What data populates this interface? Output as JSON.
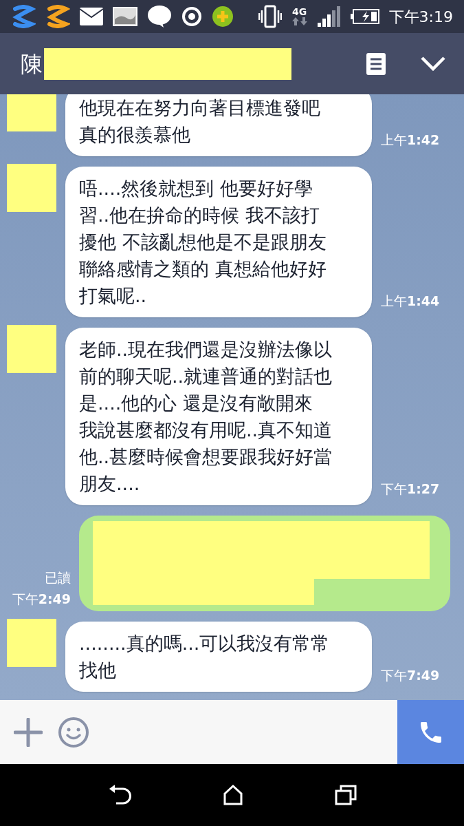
{
  "status_bar": {
    "network": "4G",
    "time": "下午3:19"
  },
  "header": {
    "title": "陳"
  },
  "messages": [
    {
      "kind": "incoming",
      "lines": [
        "他現在在努力向著目標進發吧",
        "真的很羨慕他"
      ],
      "time": "上午**1:42**"
    },
    {
      "kind": "incoming",
      "lines": [
        "唔....然後就想到 他要好好學",
        "習..他在拚命的時候 我不該打",
        "擾他 不該亂想他是不是跟朋友",
        "聯絡感情之類的 真想給他好好",
        "打氣呢.."
      ],
      "time": "上午**1:44**"
    },
    {
      "kind": "incoming",
      "lines": [
        "老師..現在我們還是沒辦法像以",
        "前的聊天呢..就連普通的對話也",
        "是....他的心 還是沒有敞開來",
        "我說甚麼都沒有用呢..真不知道",
        "他..甚麼時候會想要跟我好好當",
        "朋友...."
      ],
      "time": "下午**1:27**"
    },
    {
      "kind": "outgoing",
      "read": "已讀",
      "time": "下午**2:49**"
    },
    {
      "kind": "incoming",
      "lines": [
        "........真的嗎...可以我沒有常常",
        "找他"
      ],
      "time": "下午**7:49**"
    }
  ]
}
